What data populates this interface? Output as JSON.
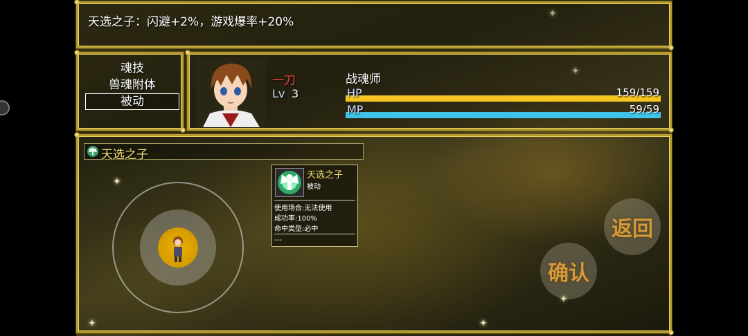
{
  "help": {
    "text": "天选之子：闪避+2%，游戏爆率+20%"
  },
  "commands": {
    "items": [
      "魂技",
      "兽魂附体",
      "被动"
    ],
    "selected_index": 2
  },
  "actor": {
    "name": "一刀",
    "level_label": "Lv",
    "level": "3",
    "class_name": "战魂师",
    "hp": {
      "label": "HP",
      "value_text": "159/159",
      "ratio": 1.0,
      "color": "#f5c521"
    },
    "mp": {
      "label": "MP",
      "value_text": "59/59",
      "ratio": 1.0,
      "color": "#3fc3e8"
    }
  },
  "skill_list": {
    "items": [
      {
        "name": "天选之子",
        "icon": "angel-wings-icon"
      }
    ]
  },
  "tooltip": {
    "name": "天选之子",
    "type": "被动",
    "icon": "angel-wings-icon",
    "usage": "使用场合:无法使用",
    "success": "成功率:100%",
    "hit_type": "命中类型:必中",
    "footer": "---"
  },
  "controls": {
    "back_label": "返回",
    "confirm_label": "确认"
  },
  "colors": {
    "frame_gold": "#b59a2c",
    "name_red": "#f4443b",
    "skill_yellow": "#f2e27a"
  }
}
